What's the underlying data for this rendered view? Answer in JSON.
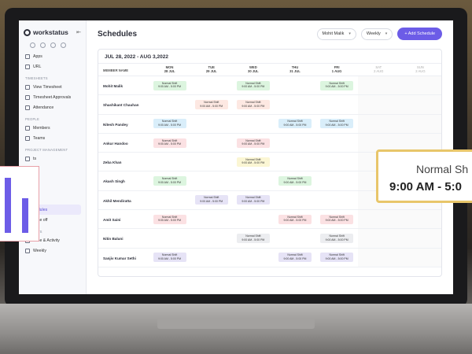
{
  "sidebar": {
    "brand": "workstatus",
    "items": [
      {
        "label": "Apps",
        "icon": "apps-icon"
      },
      {
        "label": "URL",
        "icon": "link-icon"
      }
    ],
    "sections": [
      {
        "title": "TIMESHEETS",
        "items": [
          "View Timesheet",
          "Timesheet Approvals",
          "Attendance"
        ]
      },
      {
        "title": "PEOPLE",
        "items": [
          "Members",
          "Teams"
        ]
      },
      {
        "title": "PROJECT MANAGEMENT",
        "items": [
          "ts",
          "s",
          "s",
          "ites"
        ]
      },
      {
        "title": "AVES",
        "items": [
          "hedules",
          "Time off"
        ]
      },
      {
        "title": "REPORTS",
        "items": [
          "Time & Activity",
          "Weekly"
        ]
      }
    ]
  },
  "header": {
    "title": "Schedules",
    "member_select": "Mohit Malik",
    "view_select": "Weekly",
    "add_button": "+ Add Schedule"
  },
  "schedule": {
    "range": "JUL 28, 2022 - AUG 3,2022",
    "member_header": "MEMBER NAME",
    "days": [
      {
        "dow": "MON",
        "date": "28 JUL",
        "weekend": false
      },
      {
        "dow": "TUE",
        "date": "29 JUL",
        "weekend": false
      },
      {
        "dow": "WED",
        "date": "30 JUL",
        "weekend": false
      },
      {
        "dow": "THU",
        "date": "31 JUL",
        "weekend": false
      },
      {
        "dow": "FRI",
        "date": "1 AUG",
        "weekend": false
      },
      {
        "dow": "SAT",
        "date": "2 AUG",
        "weekend": true
      },
      {
        "dow": "SUN",
        "date": "2 AUG",
        "weekend": true
      }
    ],
    "shift_label": "Normal Shift",
    "shift_time": "9:00 AM - 5:00 PM",
    "rows": [
      {
        "member": "Mohit Malik",
        "cells": [
          "green",
          "",
          "green",
          "",
          "green",
          "",
          ""
        ]
      },
      {
        "member": "Shashikant Chauhan",
        "cells": [
          "",
          "peach",
          "peach",
          "",
          "",
          "",
          ""
        ]
      },
      {
        "member": "Nitesh Pandey",
        "cells": [
          "blue",
          "",
          "",
          "blue",
          "blue",
          "",
          ""
        ]
      },
      {
        "member": "Ankur Handoo",
        "cells": [
          "pink",
          "",
          "pink",
          "",
          "",
          "",
          ""
        ]
      },
      {
        "member": "Zeba Khan",
        "cells": [
          "",
          "",
          "yellow",
          "",
          "",
          "",
          ""
        ]
      },
      {
        "member": "Akash Singh",
        "cells": [
          "green",
          "",
          "",
          "green",
          "",
          "",
          ""
        ]
      },
      {
        "member": "Akhil Mendiratta",
        "cells": [
          "",
          "lav",
          "lav",
          "",
          "",
          "",
          ""
        ]
      },
      {
        "member": "Amit Saini",
        "cells": [
          "pink",
          "",
          "",
          "pink",
          "pink",
          "",
          ""
        ]
      },
      {
        "member": "Nitin Baluni",
        "cells": [
          "",
          "",
          "gray",
          "",
          "gray",
          "",
          ""
        ]
      },
      {
        "member": "Sanjiv Kumar Sethi",
        "cells": [
          "lav",
          "",
          "",
          "lav",
          "lav",
          "",
          ""
        ]
      }
    ]
  },
  "popup": {
    "label": "Normal Sh",
    "time": "9:00 AM - 5:0"
  },
  "colors": {
    "accent": "#6c5ce7",
    "green": "#dcf5df",
    "pink": "#fbe1e3",
    "blue": "#d9eefa",
    "yellow": "#fbf6d4",
    "lavender": "#e6e3f6",
    "peach": "#fde8e2",
    "gray": "#ecedf0"
  }
}
